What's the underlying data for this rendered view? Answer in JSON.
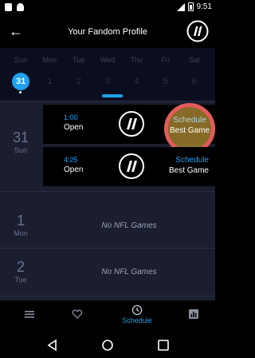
{
  "status_bar": {
    "time": "9:51"
  },
  "app_bar": {
    "title": "Your Fandom Profile"
  },
  "week": {
    "day_names": [
      "Sun",
      "Mon",
      "Tue",
      "Wed",
      "Thu",
      "Fri",
      "Sat"
    ],
    "dates": [
      "31",
      "1",
      "2",
      "3",
      "4",
      "5",
      "6"
    ],
    "selected_index": 0
  },
  "schedule": {
    "days": [
      {
        "date": "31",
        "day": "Sun"
      },
      {
        "date": "1",
        "day": "Mon",
        "message": "No NFL Games"
      },
      {
        "date": "2",
        "day": "Tue",
        "message": "No NFL Games"
      }
    ],
    "games": [
      {
        "time": "1:00",
        "status": "Open",
        "schedule_label": "Schedule",
        "best_label": "Best Game"
      },
      {
        "time": "4:25",
        "status": "Open",
        "schedule_label": "Schedule",
        "best_label": "Best Game"
      }
    ]
  },
  "tab_bar": {
    "active_label": "Schedule"
  },
  "colors": {
    "accent": "#1ea1ee",
    "highlight_ring": "#e35b5b",
    "highlight_fill": "#9d7d2b",
    "list_bg": "#1b1e2f"
  }
}
